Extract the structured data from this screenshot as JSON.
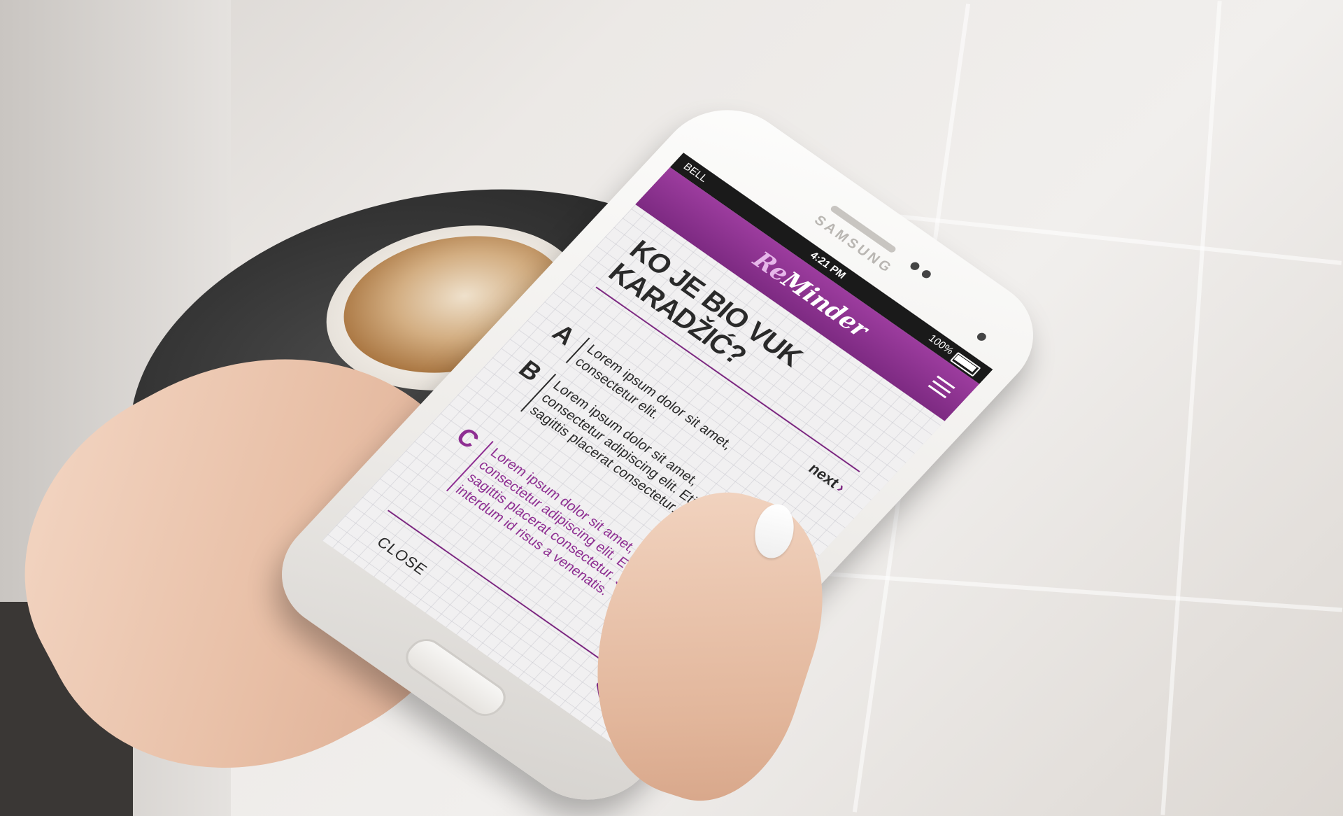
{
  "device": {
    "brand": "SAMSUNG"
  },
  "status_bar": {
    "carrier": "BELL",
    "time": "4:21 PM",
    "battery": "100%"
  },
  "app": {
    "logo_prefix": "Re",
    "logo_suffix": "Minder",
    "accent_color": "#8e2e92"
  },
  "quiz": {
    "question": "KO JE BIO VUK KARADŽIĆ?",
    "next_label": "next",
    "close_label": "CLOSE",
    "answers": [
      {
        "letter": "A",
        "text": "Lorem ipsum dolor sit amet, consectetur elit.",
        "selected": false
      },
      {
        "letter": "B",
        "text": "Lorem ipsum dolor sit amet, consectetur adipiscing elit. Etiam sagittis placerat consectetur.",
        "selected": false
      },
      {
        "letter": "C",
        "text": "Lorem ipsum dolor sit amet, consectetur adipiscing elit. Etiam sagittis placerat consectetur. Sed interdum id risus a venenatis.",
        "selected": true
      }
    ]
  }
}
